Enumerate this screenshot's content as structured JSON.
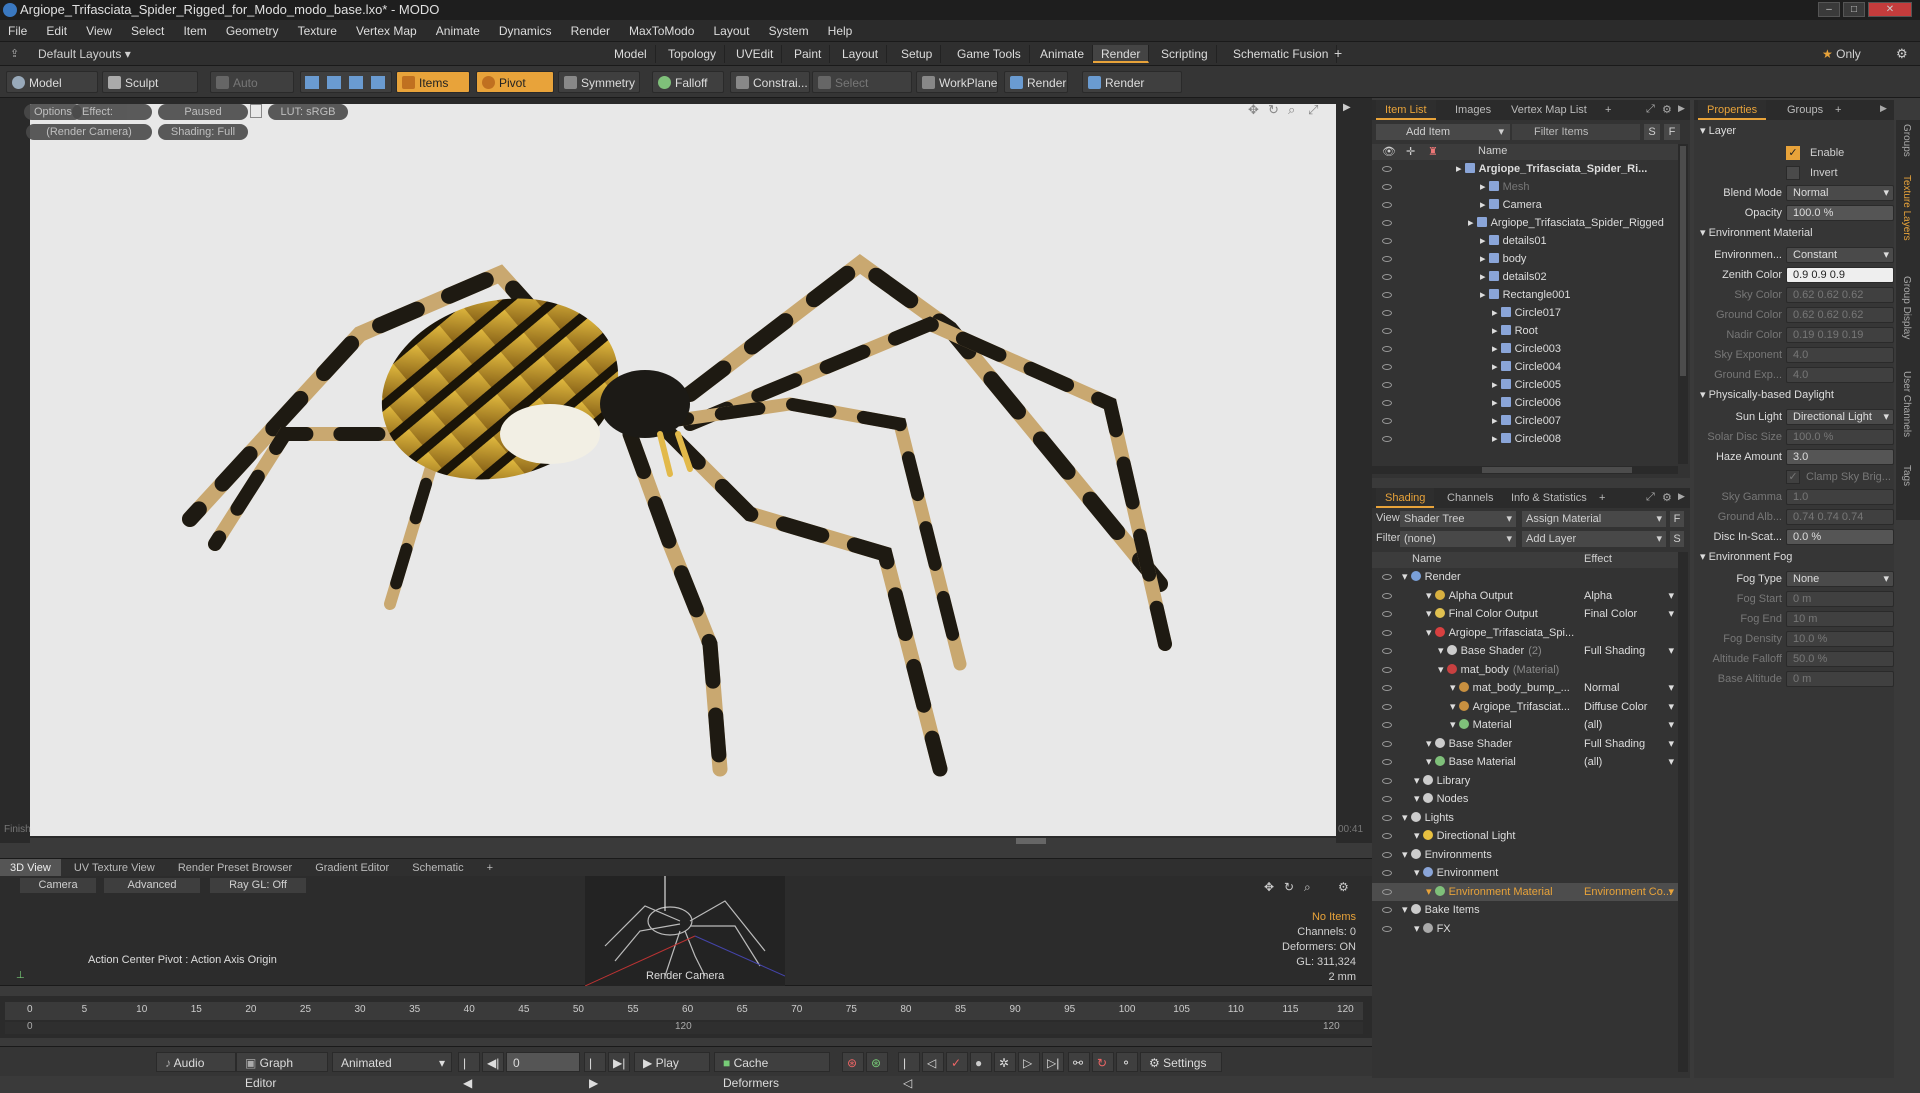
{
  "window": {
    "title": "Argiope_Trifasciata_Spider_Rigged_for_Modo_modo_base.lxo* - MODO"
  },
  "menu": [
    "File",
    "Edit",
    "View",
    "Select",
    "Item",
    "Geometry",
    "Texture",
    "Vertex Map",
    "Animate",
    "Dynamics",
    "Render",
    "MaxToModo",
    "Layout",
    "System",
    "Help"
  ],
  "layouts": {
    "selector": "Default Layouts",
    "tabs": [
      "Model",
      "Topology",
      "UVEdit",
      "Paint",
      "Layout",
      "Setup",
      "Game Tools",
      "Animate",
      "Render",
      "Scripting",
      "Schematic Fusion"
    ],
    "active": "Render",
    "only_label": "Only"
  },
  "toolbar": {
    "model": "Model",
    "sculpt": "Sculpt",
    "auto_select": "Auto Select",
    "items": "Items",
    "pivot": "Pivot",
    "symmetry": "Symmetry",
    "falloff": "Falloff",
    "constrain": "Constrai...",
    "select_through": "Select Through",
    "workplane": "WorkPlane",
    "render": "Render",
    "render_window": "Render Window"
  },
  "viewport": {
    "chips": {
      "options": "Options",
      "effect": "Effect: (Shadi...",
      "paused": "Paused",
      "lut": "LUT: sRGB",
      "camera": "(Render Camera)",
      "shading": "Shading: Full"
    },
    "status_left": "Finish",
    "time": "00:41",
    "accent": "#e8a33a"
  },
  "bottom_tabs": [
    "3D View",
    "UV Texture View",
    "Render Preset Browser",
    "Gradient Editor",
    "Schematic"
  ],
  "lower_view": {
    "camera": "Camera",
    "advanced": "Advanced",
    "raygl": "Ray GL: Off",
    "action_center": "Action Center Pivot : Action Axis Origin",
    "render_camera": "Render Camera",
    "no_items": "No Items",
    "channels": "Channels: 0",
    "deformers": "Deformers: ON",
    "gl": "GL: 311,324",
    "unit": "2 mm"
  },
  "timeline": {
    "ticks": [
      "0",
      "5",
      "10",
      "15",
      "20",
      "25",
      "30",
      "35",
      "40",
      "45",
      "50",
      "55",
      "60",
      "65",
      "70",
      "75",
      "80",
      "85",
      "90",
      "95",
      "100",
      "105",
      "110",
      "115",
      "120"
    ],
    "sub_start": "0",
    "sub_mid": "120",
    "sub_end": "120"
  },
  "transport": {
    "audio": "Audio",
    "graph_editor": "Graph Editor",
    "animated": "Animated",
    "frame": "0",
    "play": "Play",
    "cache_deformers": "Cache Deformers",
    "settings": "Settings"
  },
  "item_list": {
    "tabs": [
      "Item List",
      "Images",
      "Vertex Map List"
    ],
    "add_item": "Add Item",
    "filter": "Filter Items",
    "s_btn": "S",
    "f_btn": "F",
    "col_name": "Name",
    "items": [
      {
        "name": "Argiope_Trifasciata_Spider_Ri...",
        "indent": 0,
        "bold": true
      },
      {
        "name": "Mesh",
        "indent": 2,
        "dim": true
      },
      {
        "name": "Camera",
        "indent": 2
      },
      {
        "name": "Argiope_Trifasciata_Spider_Rigged",
        "indent": 1
      },
      {
        "name": "details01",
        "indent": 2
      },
      {
        "name": "body",
        "indent": 2
      },
      {
        "name": "details02",
        "indent": 2
      },
      {
        "name": "Rectangle001",
        "indent": 2
      },
      {
        "name": "Circle017",
        "indent": 3
      },
      {
        "name": "Root",
        "indent": 3
      },
      {
        "name": "Circle003",
        "indent": 3
      },
      {
        "name": "Circle004",
        "indent": 3
      },
      {
        "name": "Circle005",
        "indent": 3
      },
      {
        "name": "Circle006",
        "indent": 3
      },
      {
        "name": "Circle007",
        "indent": 3
      },
      {
        "name": "Circle008",
        "indent": 3
      }
    ]
  },
  "shading": {
    "tabs": [
      "Shading",
      "Channels",
      "Info & Statistics"
    ],
    "view_label": "View",
    "view_value": "Shader Tree",
    "assign": "Assign Material",
    "filter_label": "Filter",
    "filter_value": "(none)",
    "add_layer": "Add Layer",
    "col_name": "Name",
    "col_effect": "Effect",
    "rows": [
      {
        "name": "Render",
        "effect": "",
        "indent": 0
      },
      {
        "name": "Alpha Output",
        "effect": "Alpha",
        "indent": 2
      },
      {
        "name": "Final Color Output",
        "effect": "Final Color",
        "indent": 2
      },
      {
        "name": "Argiope_Trifasciata_Spi...",
        "effect": "",
        "indent": 2
      },
      {
        "name": "Base Shader",
        "suffix": "(2)",
        "effect": "Full Shading",
        "indent": 3
      },
      {
        "name": "mat_body",
        "suffix": "(Material)",
        "effect": "",
        "indent": 3
      },
      {
        "name": "mat_body_bump_...",
        "effect": "Normal",
        "indent": 4
      },
      {
        "name": "Argiope_Trifasciat...",
        "effect": "Diffuse Color",
        "indent": 4
      },
      {
        "name": "Material",
        "effect": "(all)",
        "indent": 4
      },
      {
        "name": "Base Shader",
        "effect": "Full Shading",
        "indent": 2
      },
      {
        "name": "Base Material",
        "effect": "(all)",
        "indent": 2
      },
      {
        "name": "Library",
        "effect": "",
        "indent": 1
      },
      {
        "name": "Nodes",
        "effect": "",
        "indent": 1
      },
      {
        "name": "Lights",
        "effect": "",
        "indent": 0
      },
      {
        "name": "Directional Light",
        "effect": "",
        "indent": 1
      },
      {
        "name": "Environments",
        "effect": "",
        "indent": 0
      },
      {
        "name": "Environment",
        "effect": "",
        "indent": 1
      },
      {
        "name": "Environment Material",
        "effect": "Environment Co...",
        "indent": 2,
        "selected": true
      },
      {
        "name": "Bake Items",
        "effect": "",
        "indent": 0
      },
      {
        "name": "FX",
        "effect": "",
        "indent": 1
      }
    ]
  },
  "properties": {
    "tabs": [
      "Properties",
      "Groups"
    ],
    "vtabs": [
      "Groups",
      "Texture Layers",
      "Group Display",
      "User Channels",
      "Tags"
    ],
    "layer": "Layer",
    "enable": "Enable",
    "invert": "Invert",
    "blend_label": "Blend Mode",
    "blend_value": "Normal",
    "opacity_label": "Opacity",
    "opacity_value": "100.0 %",
    "env_material": "Environment Material",
    "env_label": "Environmen...",
    "env_value": "Constant",
    "zenith_label": "Zenith Color",
    "zenith_value": "0.9   0.9   0.9",
    "sky_label": "Sky Color",
    "sky_value": "0.62  0.62  0.62",
    "ground_label": "Ground Color",
    "ground_value": "0.62  0.62  0.62",
    "nadir_label": "Nadir Color",
    "nadir_value": "0.19  0.19  0.19",
    "skyexp_label": "Sky Exponent",
    "skyexp_value": "4.0",
    "groundexp_label": "Ground Exp...",
    "groundexp_value": "4.0",
    "daylight": "Physically-based Daylight",
    "sun_label": "Sun Light",
    "sun_value": "Directional Light",
    "solar_label": "Solar Disc Size",
    "solar_value": "100.0 %",
    "haze_label": "Haze Amount",
    "haze_value": "3.0",
    "clamp": "Clamp Sky Brig...",
    "skygamma_label": "Sky Gamma",
    "skygamma_value": "1.0",
    "groundalb_label": "Ground Alb...",
    "groundalb_value": "0.74  0.74  0.74",
    "disc_label": "Disc In-Scat...",
    "disc_value": "0.0 %",
    "fog": "Environment Fog",
    "fogtype_label": "Fog Type",
    "fogtype_value": "None",
    "fogstart_label": "Fog Start",
    "fogstart_value": "0 m",
    "fogend_label": "Fog End",
    "fogend_value": "10 m",
    "fogdensity_label": "Fog Density",
    "fogdensity_value": "10.0 %",
    "altfall_label": "Altitude Falloff",
    "altfall_value": "50.0 %",
    "basealt_label": "Base Altitude",
    "basealt_value": "0 m"
  }
}
